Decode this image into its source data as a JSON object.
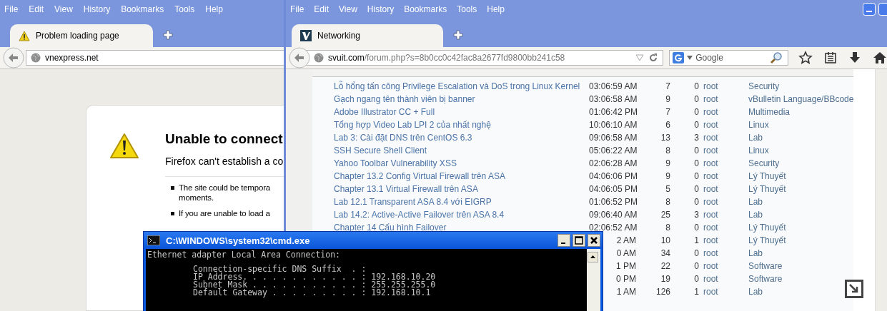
{
  "left_browser": {
    "menu": [
      "File",
      "Edit",
      "View",
      "History",
      "Bookmarks",
      "Tools",
      "Help"
    ],
    "tab": {
      "title": "Problem loading page",
      "selected": true
    },
    "url": "vnexpress.net",
    "error": {
      "title": "Unable to connect",
      "message": "Firefox can't establish a co",
      "bullets": [
        {
          "lines": [
            "The site could be tempora",
            "moments."
          ]
        },
        {
          "lines": [
            "If you are unable to load a"
          ]
        }
      ]
    }
  },
  "right_browser": {
    "menu": [
      "File",
      "Edit",
      "View",
      "History",
      "Bookmarks",
      "Tools",
      "Help"
    ],
    "tab": {
      "title": "Networking",
      "selected": true
    },
    "url_domain": "svuit.com",
    "url_path": "/forum.php?s=8b0cc0c42fac8a2677fd9800bb241c58",
    "search": {
      "placeholder": "Google"
    },
    "threads": [
      {
        "title": "Lỗ hổng tấn công Privilege Escalation và DoS trong Linux Kernel",
        "time": "03:06:59 AM",
        "replies": "7",
        "views": "0",
        "author": "root",
        "forum": "Security"
      },
      {
        "title": "Gạch ngang tên thành viên bị banner",
        "time": "03:06:58 AM",
        "replies": "9",
        "views": "0",
        "author": "root",
        "forum": "vBulletin Language/BBcode"
      },
      {
        "title": "Adobe Illustrator CC + Full",
        "time": "01:06:42 PM",
        "replies": "7",
        "views": "0",
        "author": "root",
        "forum": "Multimedia"
      },
      {
        "title": "Tổng hợp Video Lab LPI 2 của nhất nghệ",
        "time": "10:06:10 AM",
        "replies": "6",
        "views": "0",
        "author": "root",
        "forum": "Linux"
      },
      {
        "title": "Lab 3: Cài đặt DNS trên CentOS 6.3",
        "time": "09:06:58 AM",
        "replies": "13",
        "views": "3",
        "author": "root",
        "forum": "Lab"
      },
      {
        "title": "SSH Secure Shell Client",
        "time": "05:06:22 AM",
        "replies": "8",
        "views": "0",
        "author": "root",
        "forum": "Linux"
      },
      {
        "title": "Yahoo Toolbar Vulnerability XSS",
        "time": "02:06:28 AM",
        "replies": "9",
        "views": "0",
        "author": "root",
        "forum": "Security"
      },
      {
        "title": "Chapter 13.2 Config Virtual Firewall trên ASA",
        "time": "04:06:06 PM",
        "replies": "9",
        "views": "0",
        "author": "root",
        "forum": "Lý Thuyết"
      },
      {
        "title": "Chapter 13.1 Virtual Firewall trên ASA",
        "time": "04:06:05 PM",
        "replies": "5",
        "views": "0",
        "author": "root",
        "forum": "Lý Thuyết"
      },
      {
        "title": "Lab 12.1 Transparent ASA 8.4 với EIGRP",
        "time": "01:06:52 PM",
        "replies": "8",
        "views": "0",
        "author": "root",
        "forum": "Lab"
      },
      {
        "title": "Lab 14.2: Active-Active Failover trên ASA 8.4",
        "time": "09:06:40 AM",
        "replies": "25",
        "views": "3",
        "author": "root",
        "forum": "Lab"
      },
      {
        "title": "Chapter 14 Cấu hình Failover",
        "time": "02:06:52 AM",
        "replies": "8",
        "views": "0",
        "author": "root",
        "forum": "Lý Thuyết"
      },
      {
        "time": "2 AM",
        "replies": "10",
        "views": "1",
        "author": "root",
        "forum": "Lý Thuyết"
      },
      {
        "time": "0 AM",
        "replies": "34",
        "views": "0",
        "author": "root",
        "forum": "Lab"
      },
      {
        "time": "1 PM",
        "replies": "22",
        "views": "0",
        "author": "root",
        "forum": "Software"
      },
      {
        "time": "0 PM",
        "replies": "19",
        "views": "0",
        "author": "root",
        "forum": "Software"
      },
      {
        "time": "1 AM",
        "replies": "126",
        "views": "1",
        "author": "root",
        "forum": "Lab"
      }
    ]
  },
  "cmd": {
    "title": "C:\\WINDOWS\\system32\\cmd.exe",
    "heading": "Ethernet adapter Local Area Connection:",
    "lines": [
      "Connection-specific DNS Suffix  . :",
      "IP Address. . . . . . . . . . . . : 192.168.10.20",
      "Subnet Mask . . . . . . . . . . . : 255.255.255.0",
      "Default Gateway . . . . . . . . . : 192.168.10.1"
    ]
  }
}
